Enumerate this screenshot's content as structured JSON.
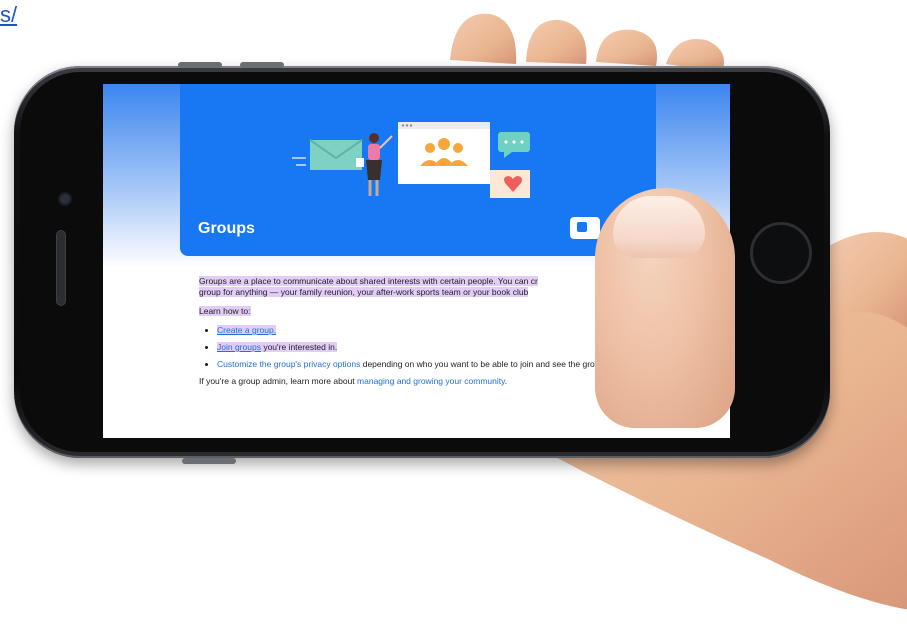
{
  "corner_link": {
    "label": "s/"
  },
  "page": {
    "hero_title": "Groups",
    "intro_line1": "Groups are a place to communicate about shared interests with certain people. You can cr",
    "intro_line2": "group for anything — your family reunion, your after-work sports team or your book club",
    "learn_how": "Learn how to:",
    "bullets": [
      {
        "link": "Create a group.",
        "rest": ""
      },
      {
        "link": "Join groups",
        "rest": " you're interested in."
      },
      {
        "link": "Customize the group's privacy options",
        "rest": " depending on who you want to be able to join and see the group."
      }
    ],
    "admin_prefix": "If you're a group admin, learn more about ",
    "admin_link": "managing and growing your community",
    "admin_suffix": "."
  },
  "colors": {
    "hero_blue": "#1877f2",
    "link_blue": "#216fdb",
    "highlight": "#e3cdf7"
  },
  "icons": [
    "envelope-icon",
    "people-icon",
    "chat-bubble-icon",
    "heart-icon",
    "hero-action-icon"
  ]
}
